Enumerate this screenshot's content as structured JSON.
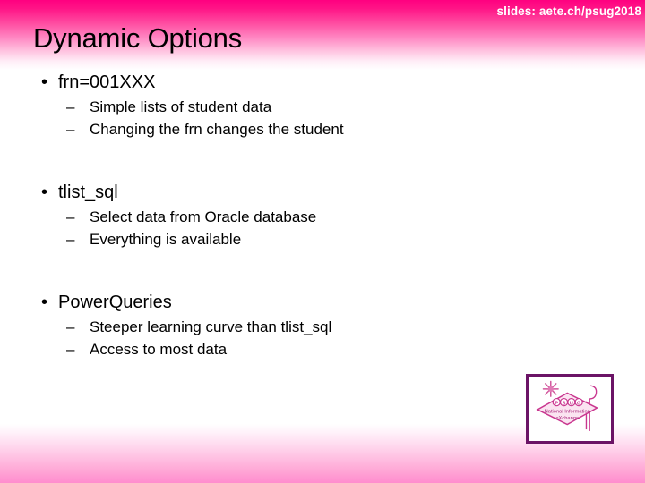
{
  "slide": {
    "header_note": "slides: aete.ch/psug2018",
    "title": "Dynamic Options",
    "colors": {
      "accent_pink": "#FF0080",
      "band_bottom_pink": "#FF8CCE",
      "logo_border_purple": "#6B1466",
      "logo_magenta": "#C9368F",
      "text_black": "#000000",
      "header_text_white": "#FFFFFF"
    },
    "bullet_marker": "•",
    "sub_bullet_marker": "–",
    "groups": [
      {
        "label": "frn=001XXX",
        "sub": [
          "Simple lists of student data",
          "Changing the frn changes the student"
        ]
      },
      {
        "label": "tlist_sql",
        "sub": [
          "Select data from Oracle database",
          "Everything is available"
        ]
      },
      {
        "label": "PowerQueries",
        "sub": [
          "Steeper learning curve than tlist_sql",
          "Access to most data"
        ]
      }
    ],
    "logo": {
      "name": "psug-national-information-exchange-logo",
      "top_text": "PSUG",
      "line1": "National Information",
      "line2": "eXchange"
    }
  }
}
